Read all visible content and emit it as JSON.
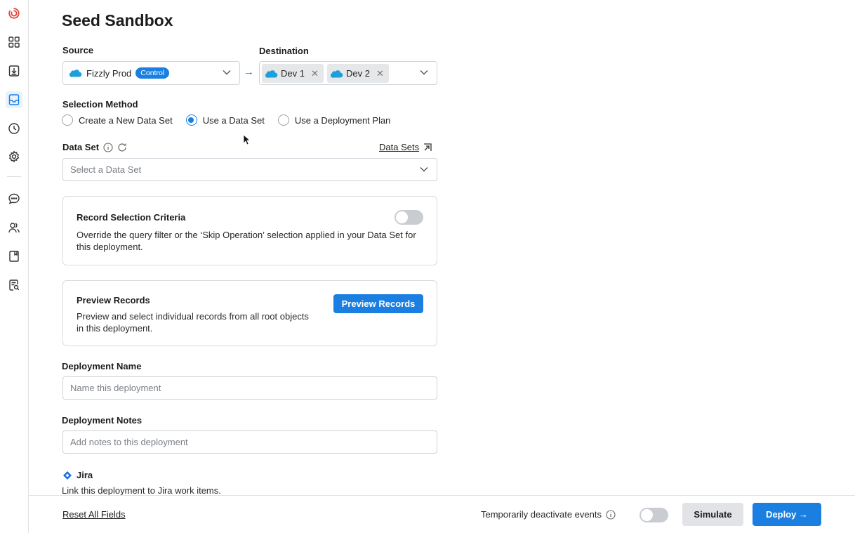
{
  "page": {
    "title": "Seed Sandbox"
  },
  "sidebar": {
    "items": [
      {
        "name": "logo"
      },
      {
        "name": "dashboard"
      },
      {
        "name": "download"
      },
      {
        "name": "sandbox",
        "active": true
      },
      {
        "name": "history"
      },
      {
        "name": "settings"
      },
      {
        "name": "chat"
      },
      {
        "name": "users"
      },
      {
        "name": "bookmark"
      },
      {
        "name": "report"
      }
    ]
  },
  "source": {
    "label": "Source",
    "value": "Fizzly Prod",
    "badge": "Control"
  },
  "destination": {
    "label": "Destination",
    "chips": [
      "Dev 1",
      "Dev 2"
    ]
  },
  "selection_method": {
    "label": "Selection Method",
    "options": [
      "Create a New Data Set",
      "Use a Data Set",
      "Use a Deployment Plan"
    ],
    "selected": "Use a Data Set"
  },
  "data_set": {
    "label": "Data Set",
    "link": "Data Sets",
    "placeholder": "Select a Data Set"
  },
  "record_criteria": {
    "title": "Record Selection Criteria",
    "description": "Override the query filter or the ‘Skip Operation’ selection applied in your Data Set for this deployment.",
    "enabled": false
  },
  "preview": {
    "title": "Preview Records",
    "description": "Preview and select individual records from all root objects in this deployment.",
    "button": "Preview Records"
  },
  "deployment_name": {
    "label": "Deployment Name",
    "placeholder": "Name this deployment"
  },
  "deployment_notes": {
    "label": "Deployment Notes",
    "placeholder": "Add notes to this deployment"
  },
  "jira": {
    "title": "Jira",
    "description": "Link this deployment to Jira work items."
  },
  "footer": {
    "reset": "Reset All Fields",
    "deactivate_label": "Temporarily deactivate events",
    "deactivate_enabled": false,
    "simulate": "Simulate",
    "deploy": "Deploy →"
  },
  "colors": {
    "accent": "#1a7fe0",
    "brand_logo": "#e2463b",
    "salesforce": "#1ba0dc"
  }
}
